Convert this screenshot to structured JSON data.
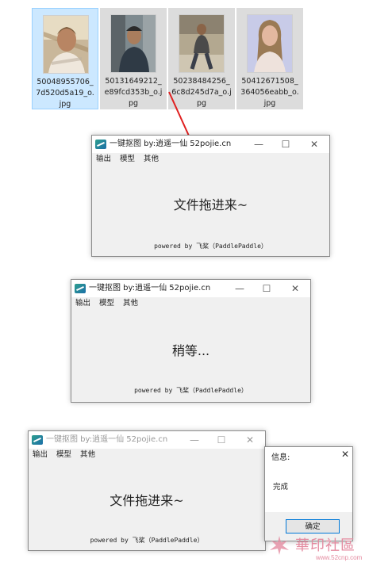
{
  "files": [
    {
      "name": "50048955706_7d520d5a19_o.jpg",
      "selected": true
    },
    {
      "name": "50131649212_e89fcd353b_o.jpg",
      "selected": false
    },
    {
      "name": "50238484256_6c8d245d7a_o.jpg",
      "selected": false
    },
    {
      "name": "50412671508_364056eabb_o.jpg",
      "selected": false
    }
  ],
  "window_title": "一键抠图  by:逍遥一仙 52pojie.cn",
  "menu": [
    "输出",
    "模型",
    "其他"
  ],
  "controls": {
    "minimize": "—",
    "maximize": "☐",
    "close": "✕"
  },
  "windows": [
    {
      "state": "drop",
      "main_text": "文件拖进来~"
    },
    {
      "state": "processing",
      "main_text": "稍等..."
    },
    {
      "state": "done",
      "main_text": "文件拖进来~"
    }
  ],
  "powered_by": "powered by 飞桨（PaddlePaddle）",
  "message_box": {
    "title": "信息:",
    "text": "完成",
    "ok_label": "确定",
    "close": "✕"
  },
  "watermark": {
    "text": "華印社區",
    "url": "www.52cnp.com"
  },
  "colors": {
    "selection": "#cce8ff",
    "arrow": "#e02020",
    "window_bg": "#f0f0f0",
    "button_border": "#0078d7"
  }
}
